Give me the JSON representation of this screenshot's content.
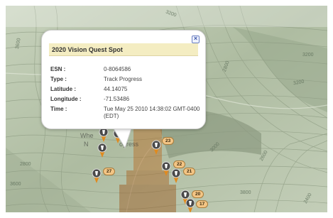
{
  "popup": {
    "title": "2020 Vision Quest Spot",
    "close_icon": "close-x-icon",
    "fields": [
      {
        "label": "ESN :",
        "value": "0-8064586"
      },
      {
        "label": "Type :",
        "value": "Track Progress"
      },
      {
        "label": "Latitude :",
        "value": "44.14075"
      },
      {
        "label": "Longitude :",
        "value": "-71.53486"
      },
      {
        "label": "Time :",
        "value": "Tue May 25 2010 14:38:02 GMT-0400 (EDT)"
      }
    ]
  },
  "behind_popup_text": {
    "line1": "Whe",
    "line2": "N",
    "line3": "ogress"
  },
  "contour_labels": [
    "3600",
    "3200",
    "3200",
    "2800",
    "3200",
    "3000",
    "2600",
    "2800",
    "3600",
    "3800",
    "2400"
  ],
  "markers": {
    "icon": "map-pin-marker-icon",
    "badges": [
      "23",
      "27",
      "22",
      "21",
      "20",
      "17"
    ]
  },
  "colors": {
    "terrain": "#bcc8b0",
    "popup_title_bg": "#f4edc2",
    "badge_bg": "#f3c585",
    "marker_pin": "#e08a1e",
    "marker_head": "#4a4a4a"
  }
}
